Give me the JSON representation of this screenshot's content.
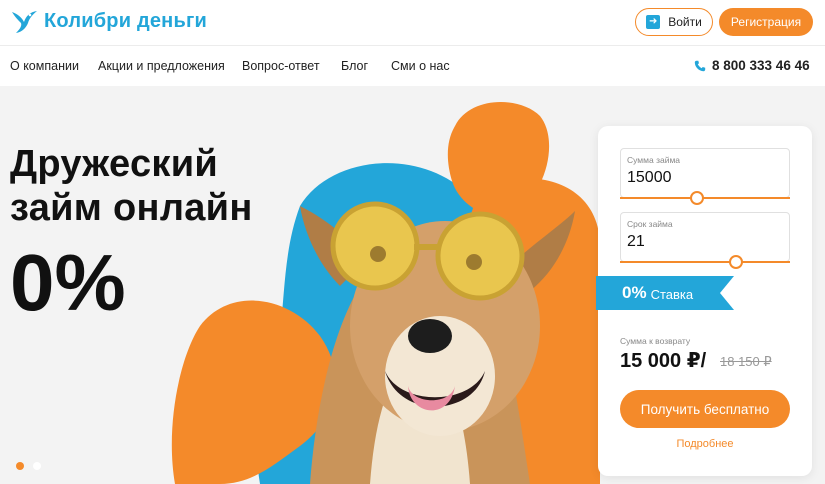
{
  "header": {
    "logo_text": "Колибри деньги",
    "login_label": "Войти",
    "register_label": "Регистрация"
  },
  "nav": {
    "items": [
      "О компании",
      "Акции и предложения",
      "Вопрос-ответ",
      "Блог",
      "Сми о нас"
    ],
    "phone": "8 800 333 46 46"
  },
  "hero": {
    "title_line1": "Дружеский",
    "title_line2": "займ онлайн",
    "rate": "0%"
  },
  "calculator": {
    "amount_label": "Сумма займа",
    "amount_value": "15000",
    "amount_slider_fraction": 0.45,
    "term_label": "Срок займа",
    "term_value": "21",
    "term_slider_fraction": 0.68,
    "rate_value": "0%",
    "rate_label": "Ставка",
    "return_label": "Сумма к возврату",
    "return_amount": "15 000 ₽/",
    "return_old": "18 150 ₽",
    "cta_label": "Получить бесплатно",
    "more_label": "Подробнее"
  },
  "slider_dots": {
    "count": 2,
    "active": 0
  },
  "colors": {
    "brand_blue": "#23a6d9",
    "brand_orange": "#f48a2a"
  },
  "icons": {
    "logo": "hummingbird-icon",
    "login": "login-arrow-icon",
    "phone": "phone-icon"
  }
}
